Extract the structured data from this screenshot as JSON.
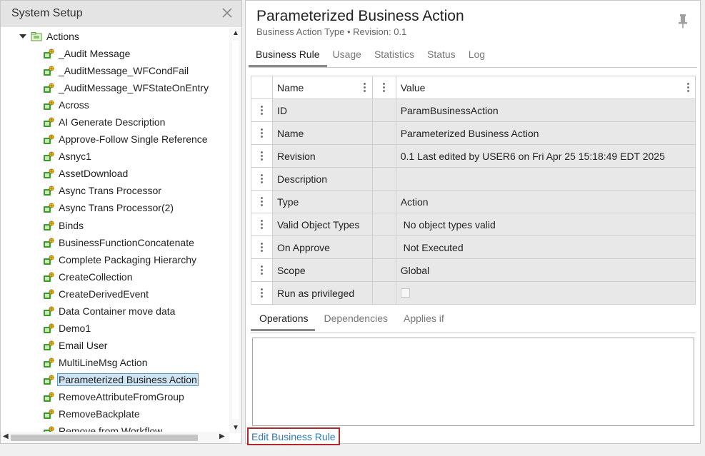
{
  "left_panel": {
    "title": "System Setup",
    "tree": {
      "root_label": "Actions",
      "items": [
        "_Audit Message",
        "_AuditMessage_WFCondFail",
        "_AuditMessage_WFStateOnEntry",
        "Across",
        "AI Generate Description",
        "Approve-Follow Single Reference",
        "Asnyc1",
        "AssetDownload",
        "Async Trans Processor",
        "Async Trans Processor(2)",
        "Binds",
        "BusinessFunctionConcatenate",
        "Complete Packaging Hierarchy",
        "CreateCollection",
        "CreateDerivedEvent",
        "Data Container move data",
        "Demo1",
        "Email User",
        "MultiLineMsg Action",
        "Parameterized Business Action",
        "RemoveAttributeFromGroup",
        "RemoveBackplate",
        "Remove from Workflow"
      ],
      "selected_index": 19
    }
  },
  "header": {
    "title": "Parameterized Business Action",
    "subtitle": "Business Action Type • Revision: 0.1"
  },
  "tabs": [
    "Business Rule",
    "Usage",
    "Statistics",
    "Status",
    "Log"
  ],
  "grid": {
    "headers": {
      "name": "Name",
      "value": "Value"
    },
    "rows": [
      {
        "name": "ID",
        "value": "ParamBusinessAction"
      },
      {
        "name": "Name",
        "value": "Parameterized Business Action"
      },
      {
        "name": "Revision",
        "value": "0.1 Last edited by USER6 on Fri Apr 25 15:18:49 EDT 2025"
      },
      {
        "name": "Description",
        "value": ""
      },
      {
        "name": "Type",
        "value": "Action"
      },
      {
        "name": "Valid Object Types",
        "value": " No object types valid"
      },
      {
        "name": "On Approve",
        "value": " Not Executed"
      },
      {
        "name": "Scope",
        "value": "Global"
      },
      {
        "name": "Run as privileged",
        "value": "",
        "checkbox": true,
        "checked": false
      }
    ]
  },
  "sub_tabs": [
    "Operations",
    "Dependencies",
    "Applies if"
  ],
  "edit_link": "Edit Business Rule",
  "colors": {
    "accent_link": "#2d78b8",
    "highlight_border": "#b0262a",
    "selection_bg": "#cfe5f3",
    "icon_green": "#3a9a2a"
  }
}
